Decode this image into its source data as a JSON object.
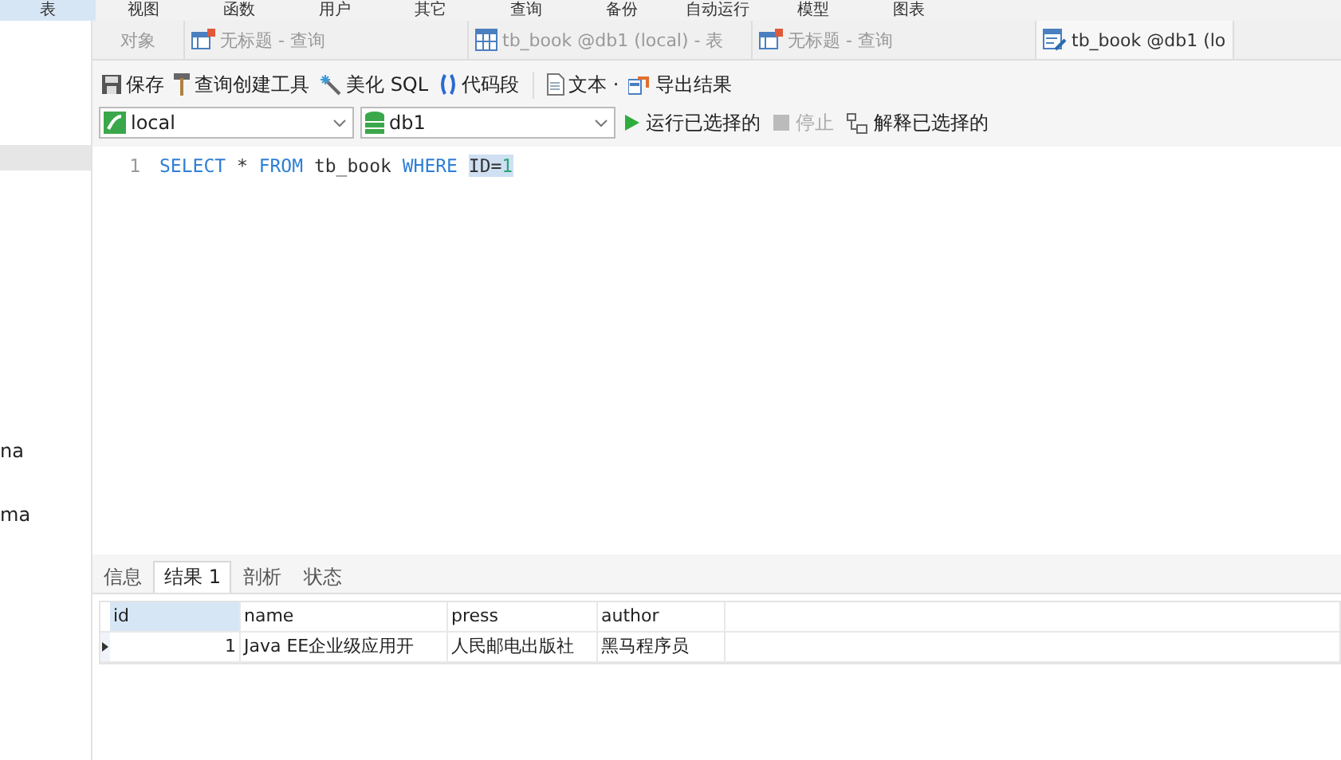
{
  "menu": [
    {
      "label": "表",
      "selected": true
    },
    {
      "label": "视图",
      "selected": false
    },
    {
      "label": "函数",
      "selected": false
    },
    {
      "label": "用户",
      "selected": false
    },
    {
      "label": "其它",
      "selected": false
    },
    {
      "label": "查询",
      "selected": false
    },
    {
      "label": "备份",
      "selected": false
    },
    {
      "label": "自动运行",
      "selected": false
    },
    {
      "label": "模型",
      "selected": false
    },
    {
      "label": "图表",
      "selected": false
    }
  ],
  "sidebar": {
    "items": [
      {
        "selected": true
      },
      {
        "label": "na",
        "selected": false
      },
      {
        "label": "ma",
        "selected": false
      }
    ]
  },
  "tabs": [
    {
      "label": "对象",
      "kind": "objects",
      "selected": false
    },
    {
      "label": "无标题 - 查询",
      "kind": "query",
      "selected": false
    },
    {
      "label": "tb_book @db1 (local) - 表",
      "kind": "table",
      "selected": false
    },
    {
      "label": "无标题 - 查询",
      "kind": "query",
      "selected": false
    },
    {
      "label": "tb_book @db1 (lo",
      "kind": "design",
      "selected": true
    }
  ],
  "toolbar": [
    {
      "label": "保存",
      "kind": "save"
    },
    {
      "label": "查询创建工具",
      "kind": "builder"
    },
    {
      "label": "美化 SQL",
      "kind": "beautify"
    },
    {
      "label": "代码段",
      "kind": "snippet"
    },
    {
      "label": "文本 ·",
      "kind": "text"
    },
    {
      "label": "导出结果",
      "kind": "export"
    }
  ],
  "connection": {
    "value": "local"
  },
  "database": {
    "value": "db1"
  },
  "run_actions": [
    {
      "label": "运行已选择的",
      "kind": "run",
      "disabled": false
    },
    {
      "label": "停止",
      "kind": "stop",
      "disabled": true
    },
    {
      "label": "解释已选择的",
      "kind": "explain",
      "disabled": false
    }
  ],
  "editor": {
    "lines": [
      {
        "number": "1",
        "tokens": [
          {
            "text": "SELECT",
            "kind": "keyword",
            "selected": false
          },
          {
            "text": " * ",
            "kind": "plain",
            "selected": false
          },
          {
            "text": "FROM",
            "kind": "keyword",
            "selected": false
          },
          {
            "text": " tb_book ",
            "kind": "plain",
            "selected": false
          },
          {
            "text": "WHERE ",
            "kind": "keyword",
            "selected": false
          },
          {
            "text": "ID=",
            "kind": "plain",
            "selected": true
          },
          {
            "text": "1",
            "kind": "number",
            "selected": true
          }
        ]
      }
    ]
  },
  "result_tabs": [
    {
      "label": "信息",
      "selected": false
    },
    {
      "label": "结果 1",
      "selected": true
    },
    {
      "label": "剖析",
      "selected": false
    },
    {
      "label": "状态",
      "selected": false
    }
  ],
  "table": {
    "columns": [
      "id",
      "name",
      "press",
      "author"
    ],
    "rows": [
      {
        "selected": true,
        "cells": [
          "1",
          "Java EE企业级应用开",
          "人民邮电出版社",
          "黑马程序员"
        ]
      }
    ]
  }
}
